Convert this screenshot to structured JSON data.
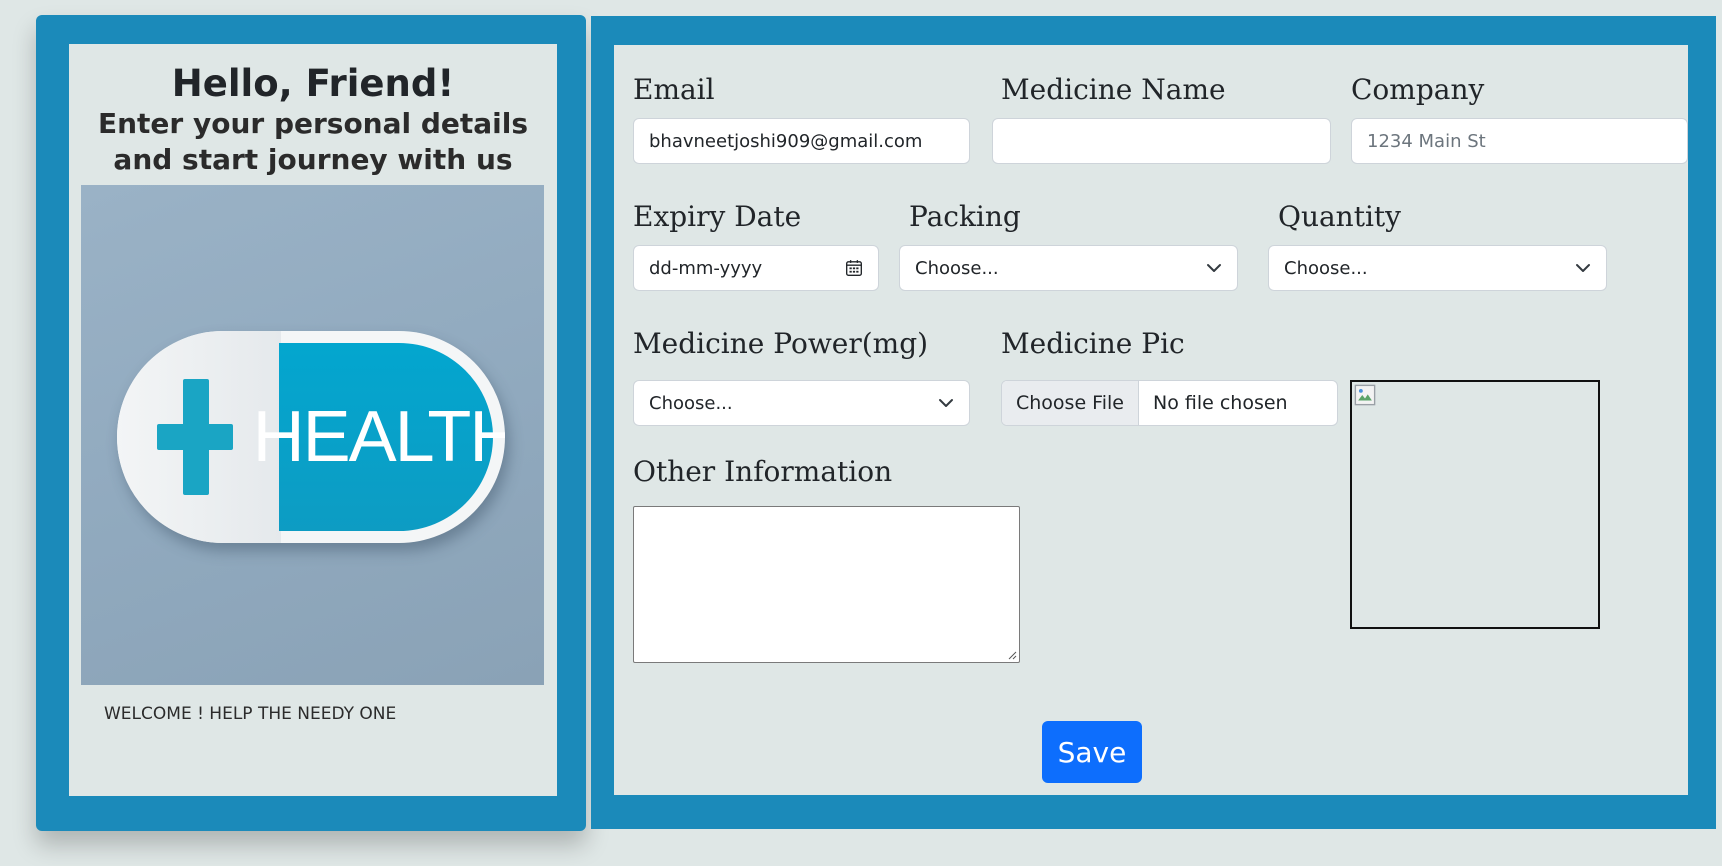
{
  "welcome_card": {
    "greeting": "Hello, Friend!",
    "subtitle_line1": "Enter your personal details",
    "subtitle_line2": "and start journey with us",
    "image_text": "HEALTH",
    "footer": "WELCOME ! HELP THE NEEDY ONE",
    "image_icon": "medical-cross-icon"
  },
  "form": {
    "email": {
      "label": "Email",
      "value": "bhavneetjoshi909@gmail.com"
    },
    "medicine_name": {
      "label": "Medicine Name",
      "value": ""
    },
    "company": {
      "label": "Company",
      "placeholder": "1234 Main St",
      "value": ""
    },
    "expiry_date": {
      "label": "Expiry Date",
      "placeholder": "dd-mm-yyyy",
      "icon": "calendar-icon"
    },
    "packing": {
      "label": "Packing",
      "selected": "Choose..."
    },
    "quantity": {
      "label": "Quantity",
      "selected": "Choose..."
    },
    "medicine_power": {
      "label": "Medicine Power(mg)",
      "selected": "Choose..."
    },
    "medicine_pic": {
      "label": "Medicine Pic",
      "button": "Choose File",
      "status": "No file chosen"
    },
    "other_information": {
      "label": "Other Information",
      "value": ""
    },
    "save_label": "Save"
  },
  "colors": {
    "card_border": "#1b8aba",
    "page_background": "#dfe7e6",
    "primary_button": "#0d6efd",
    "pill_accent": "#03a6cf"
  }
}
